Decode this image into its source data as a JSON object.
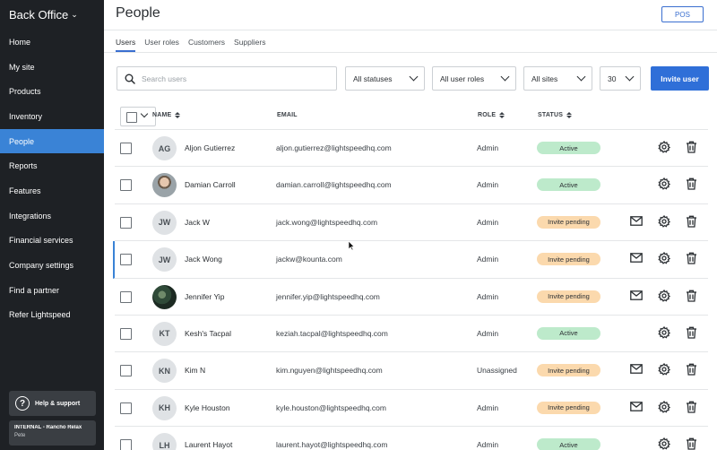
{
  "sidebar": {
    "brand": "Back Office",
    "items": [
      {
        "label": "Home"
      },
      {
        "label": "My site"
      },
      {
        "label": "Products"
      },
      {
        "label": "Inventory"
      },
      {
        "label": "People",
        "active": true
      },
      {
        "label": "Reports"
      },
      {
        "label": "Features"
      },
      {
        "label": "Integrations"
      },
      {
        "label": "Financial services"
      },
      {
        "label": "Company settings"
      },
      {
        "label": "Find a partner"
      },
      {
        "label": "Refer Lightspeed"
      }
    ],
    "help_label": "Help & support",
    "account_name": "INTERNAL - Rancho Relax",
    "account_user": "Pete"
  },
  "header": {
    "title": "People",
    "pos_label": "POS"
  },
  "tabs": [
    "Users",
    "User roles",
    "Customers",
    "Suppliers"
  ],
  "filters": {
    "search_placeholder": "Search users",
    "status": "All statuses",
    "roles": "All user roles",
    "sites": "All sites",
    "page_size": "30",
    "invite_label": "Invite user"
  },
  "table": {
    "headers": {
      "name": "NAME",
      "email": "EMAIL",
      "role": "ROLE",
      "status": "STATUS"
    },
    "rows": [
      {
        "initials": "AG",
        "name": "Aljon Gutierrez",
        "email": "aljon.gutierrez@lightspeedhq.com",
        "role": "Admin",
        "status": "Active"
      },
      {
        "initials": "",
        "name": "Damian Carroll",
        "email": "damian.carroll@lightspeedhq.com",
        "role": "Admin",
        "status": "Active"
      },
      {
        "initials": "JW",
        "name": "Jack W",
        "email": "jack.wong@lightspeedhq.com",
        "role": "Admin",
        "status": "Invite pending"
      },
      {
        "initials": "JW",
        "name": "Jack Wong",
        "email": "jackw@kounta.com",
        "role": "Admin",
        "status": "Invite pending"
      },
      {
        "initials": "",
        "name": "Jennifer Yip",
        "email": "jennifer.yip@lightspeedhq.com",
        "role": "Admin",
        "status": "Invite pending"
      },
      {
        "initials": "KT",
        "name": "Kesh's Tacpal",
        "email": "keziah.tacpal@lightspeedhq.com",
        "role": "Admin",
        "status": "Active"
      },
      {
        "initials": "KN",
        "name": "Kim N",
        "email": "kim.nguyen@lightspeedhq.com",
        "role": "Unassigned",
        "status": "Invite pending"
      },
      {
        "initials": "KH",
        "name": "Kyle Houston",
        "email": "kyle.houston@lightspeedhq.com",
        "role": "Admin",
        "status": "Invite pending"
      },
      {
        "initials": "LH",
        "name": "Laurent Hayot",
        "email": "laurent.hayot@lightspeedhq.com",
        "role": "Admin",
        "status": "Active"
      }
    ]
  },
  "colors": {
    "sidebar_bg": "#1e2125",
    "active_nav": "#3a83d6",
    "primary": "#2f6fd8",
    "active_badge": "#bdeacb",
    "pending_badge": "#fbd9ad"
  }
}
